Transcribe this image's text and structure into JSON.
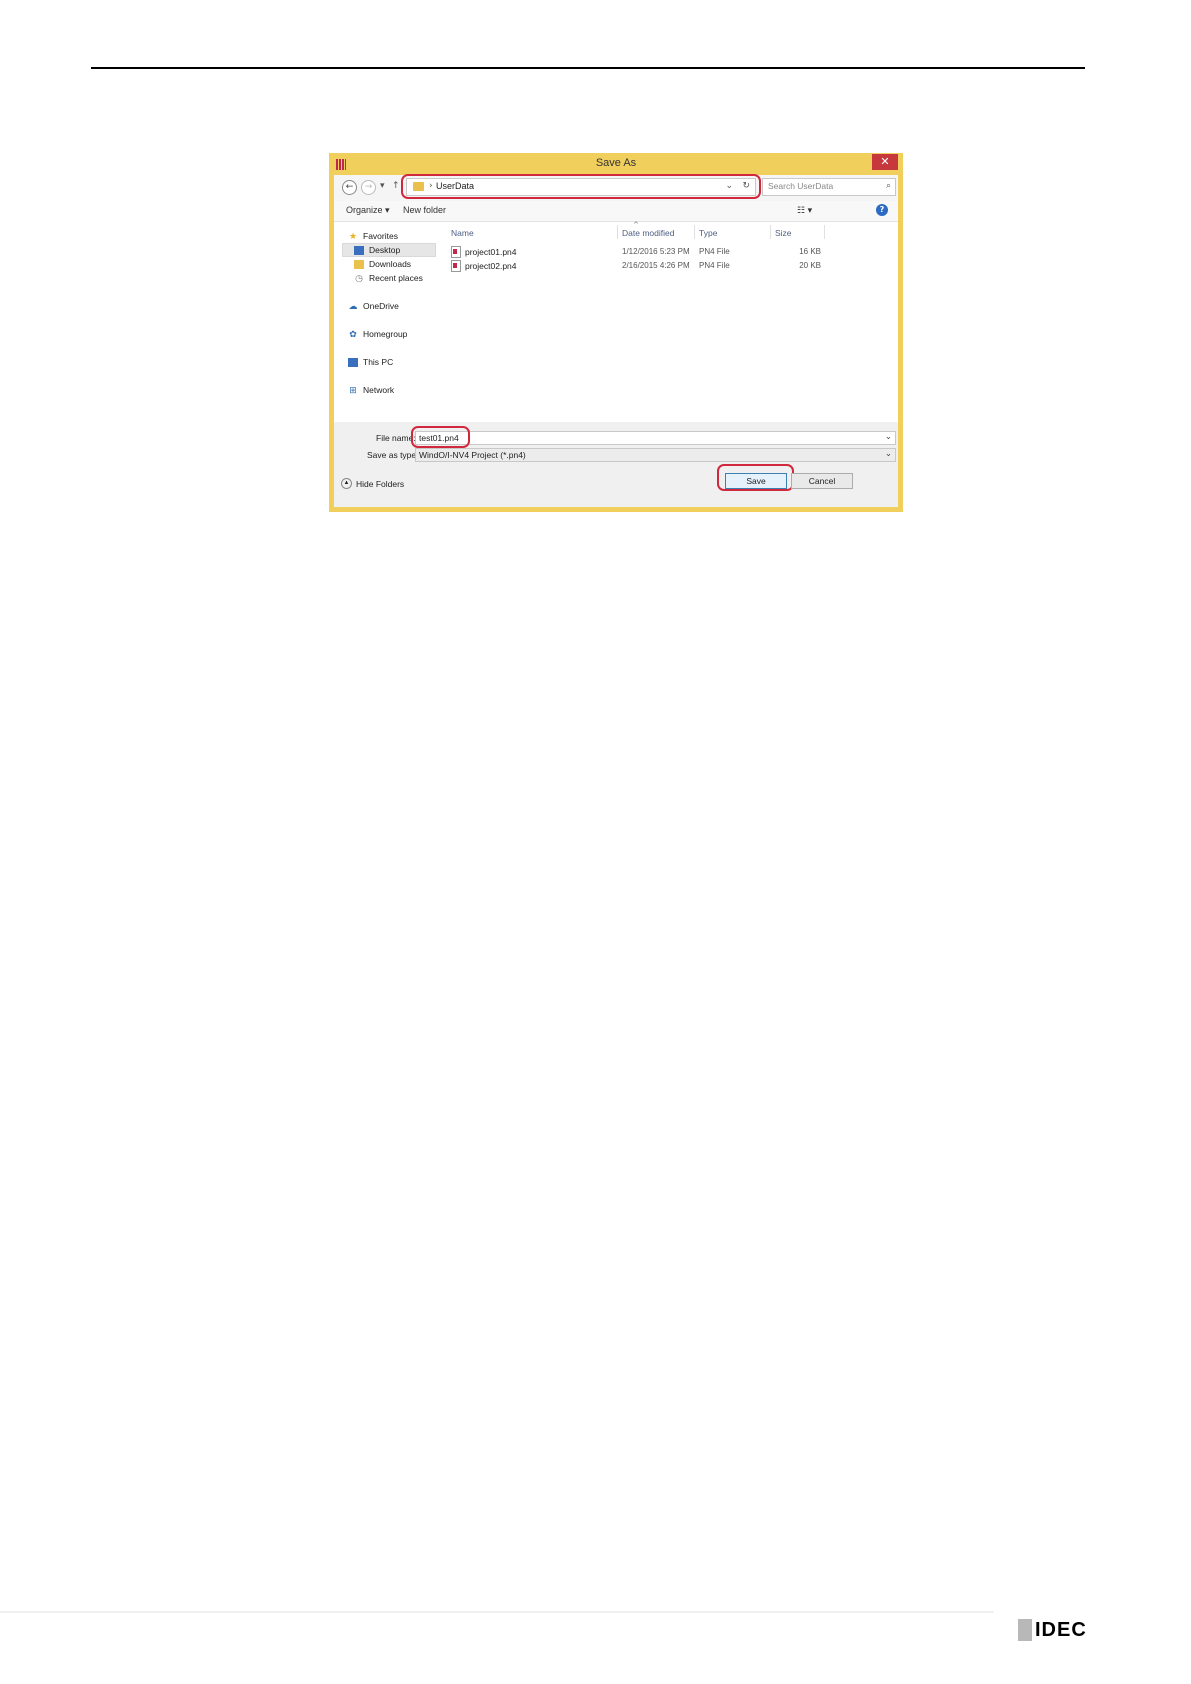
{
  "dialog": {
    "title": "Save As",
    "close_glyph": "✕",
    "address": {
      "separator": "›",
      "path": "UserData"
    },
    "search": {
      "placeholder": "Search UserData"
    },
    "toolbar": {
      "organize": "Organize ▾",
      "new_folder": "New folder",
      "view": "☷ ▾",
      "help": "?"
    },
    "sidebar": {
      "favorites": "Favorites",
      "desktop": "Desktop",
      "downloads": "Downloads",
      "recent_places": "Recent places",
      "onedrive": "OneDrive",
      "homegroup": "Homegroup",
      "this_pc": "This PC",
      "network": "Network"
    },
    "columns": {
      "name": "Name",
      "date_modified": "Date modified",
      "type": "Type",
      "size": "Size"
    },
    "files": [
      {
        "name": "project01.pn4",
        "date": "1/12/2016 5:23 PM",
        "type": "PN4 File",
        "size": "16 KB"
      },
      {
        "name": "project02.pn4",
        "date": "2/16/2015 4:26 PM",
        "type": "PN4 File",
        "size": "20 KB"
      }
    ],
    "file_name": {
      "label": "File name:",
      "value": "test01.pn4"
    },
    "save_as_type": {
      "label": "Save as type:",
      "value": "WindO/I-NV4 Project (*.pn4)"
    },
    "hide_folders": "Hide Folders",
    "save_button": "Save",
    "cancel_button": "Cancel"
  },
  "footer": {
    "brand": "IDEC"
  }
}
